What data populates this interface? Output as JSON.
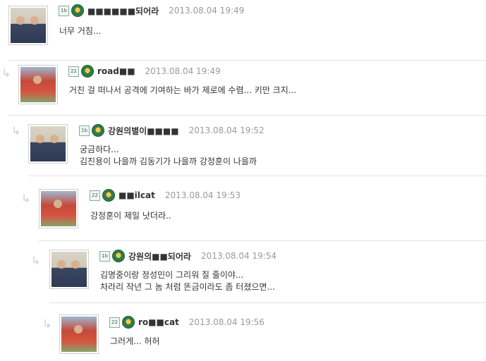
{
  "comments": [
    {
      "level_badge": "1b",
      "nickname": "■■■■■■되어라",
      "date": "2013.08.04 19:49",
      "lines": [
        "너무 거침..."
      ],
      "avatar": "avatar-a",
      "reply_icon": ""
    },
    {
      "level_badge": "22",
      "nickname": "road■■",
      "date": "2013.08.04 19:49",
      "lines": [
        "거친 걸 떠나서 공격에 기여하는 바가 제로에 수렴... 키만 크지..."
      ],
      "avatar": "avatar-b",
      "reply_icon": "↳"
    },
    {
      "level_badge": "1b",
      "nickname": "강원의별이■■■■",
      "date": "2013.08.04 19:52",
      "lines": [
        "궁금하다...",
        "김진용이 나을까 김동기가 나을까 강정훈이 나을까"
      ],
      "avatar": "avatar-a",
      "reply_icon": "↳"
    },
    {
      "level_badge": "22",
      "nickname": "■■ilcat",
      "date": "2013.08.04 19:53",
      "lines": [
        "강정훈이 제일 낫더라.."
      ],
      "avatar": "avatar-b",
      "reply_icon": "↳"
    },
    {
      "level_badge": "1b",
      "nickname": "강원의■■되어라",
      "date": "2013.08.04 19:54",
      "lines": [
        "김명중이랑 정성민이 그리워 질 줄이야...",
        "차라리 작년 그 놈 처럼 똔금이라도 좀 터졌으면..."
      ],
      "avatar": "avatar-a",
      "reply_icon": "↳"
    },
    {
      "level_badge": "22",
      "nickname": "ro■■cat",
      "date": "2013.08.04 19:56",
      "lines": [
        "그러게... 허허"
      ],
      "avatar": "avatar-b",
      "reply_icon": "↳"
    }
  ],
  "colors": {
    "nickname": "#333333",
    "date": "#9a9a9a",
    "divider": "#e2e2e2",
    "reply_arrow": "#cfcfcf"
  },
  "icons": {
    "level": "level-badge-icon",
    "emblem": "club-emblem-icon",
    "reply": "reply-arrow-icon"
  }
}
